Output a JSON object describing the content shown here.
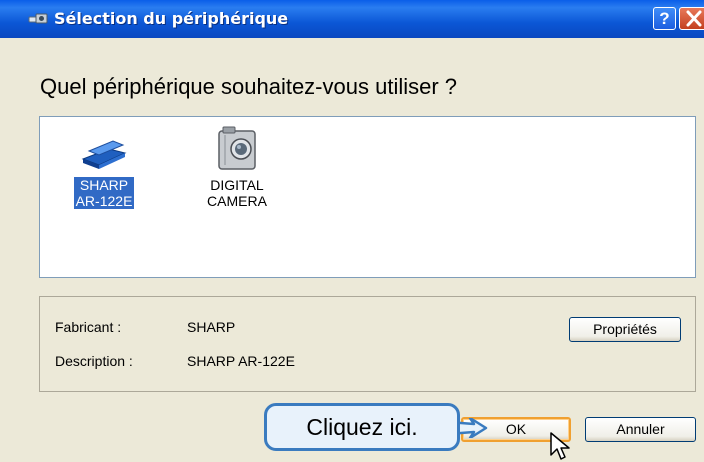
{
  "titlebar": {
    "title": "Sélection du périphérique",
    "icon": "scanner-camera-icon",
    "help_label": "?"
  },
  "dialog": {
    "heading": "Quel périphérique souhaitez-vous utiliser ?"
  },
  "devices": [
    {
      "label_line1": "SHARP",
      "label_line2": "AR-122E",
      "icon": "scanner-icon",
      "selected": true
    },
    {
      "label_line1": "DIGITAL",
      "label_line2": "CAMERA",
      "icon": "camera-icon",
      "selected": false
    }
  ],
  "info": {
    "manufacturer_label": "Fabricant :",
    "manufacturer_value": "SHARP",
    "description_label": "Description :",
    "description_value": "SHARP AR-122E",
    "properties_button": "Propriétés"
  },
  "buttons": {
    "ok": "OK",
    "cancel": "Annuler"
  },
  "callout": {
    "text": "Cliquez ici."
  },
  "colors": {
    "titlebar": "#0b57d6",
    "selection": "#316ac5",
    "dialog_bg": "#ece9d8",
    "callout_border": "#3a7bbf",
    "callout_bg": "#e8f2fb"
  }
}
